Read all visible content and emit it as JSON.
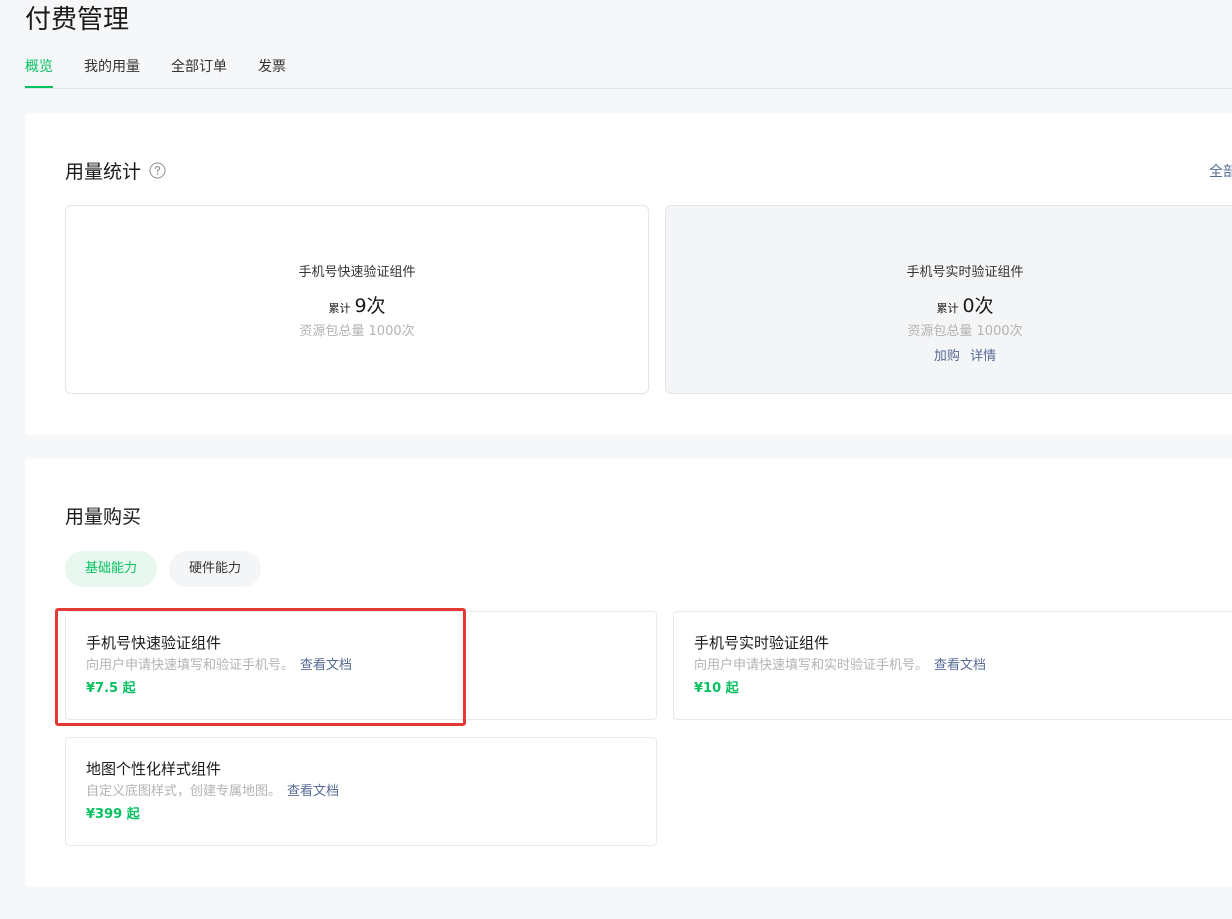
{
  "page": {
    "title": "付费管理"
  },
  "tabs": [
    {
      "label": "概览",
      "active": true
    },
    {
      "label": "我的用量",
      "active": false
    },
    {
      "label": "全部订单",
      "active": false
    },
    {
      "label": "发票",
      "active": false
    }
  ],
  "usage_stats": {
    "title": "用量统计",
    "help_icon": "question-circle-icon",
    "all_link": "全部",
    "cards": [
      {
        "name": "手机号快速验证组件",
        "count_label": "累计",
        "count_value": "9次",
        "total": "资源包总量 1000次",
        "actions": []
      },
      {
        "name": "手机号实时验证组件",
        "count_label": "累计",
        "count_value": "0次",
        "total": "资源包总量 1000次",
        "actions": [
          "加购",
          "详情"
        ]
      }
    ]
  },
  "usage_purchase": {
    "title": "用量购买",
    "categories": [
      {
        "label": "基础能力",
        "active": true
      },
      {
        "label": "硬件能力",
        "active": false
      }
    ],
    "products": [
      {
        "name": "手机号快速验证组件",
        "description": "向用户申请快速填写和验证手机号。",
        "doc_link": "查看文档",
        "price": "¥7.5 起"
      },
      {
        "name": "手机号实时验证组件",
        "description": "向用户申请快速填写和实时验证手机号。",
        "doc_link": "查看文档",
        "price": "¥10 起"
      },
      {
        "name": "地图个性化样式组件",
        "description": "自定义底图样式，创建专属地图。",
        "doc_link": "查看文档",
        "price": "¥399 起"
      }
    ]
  },
  "colors": {
    "accent": "#07c160",
    "link": "#576b95",
    "highlight": "#e53935"
  }
}
